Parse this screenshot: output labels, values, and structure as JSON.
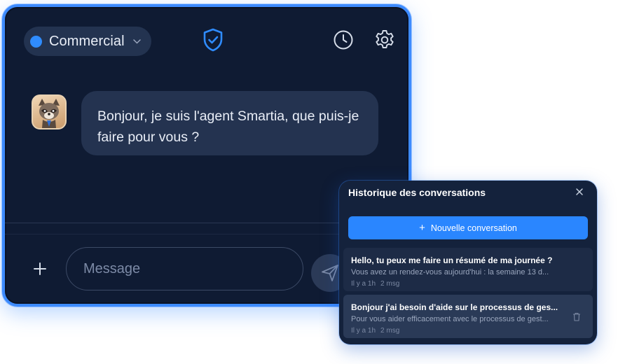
{
  "chat": {
    "agent": {
      "name": "Commercial",
      "dot_color": "#2f8cff"
    },
    "message": "Bonjour, je suis l'agent Smartia, que puis-je faire pour vous ?",
    "input_placeholder": "Message"
  },
  "history": {
    "title": "Historique des conversations",
    "new_label": "Nouvelle conversation",
    "items": [
      {
        "title": "Hello, tu peux me faire un résumé de ma journée ?",
        "preview": "Vous avez un rendez-vous aujourd'hui : la semaine 13 d...",
        "time": "Il y a 1h",
        "count": "2 msg"
      },
      {
        "title": "Bonjour j'ai besoin d'aide sur le processus de ges...",
        "preview": "Pour vous aider efficacement avec le processus de gest...",
        "time": "Il y a 1h",
        "count": "2 msg"
      }
    ]
  },
  "colors": {
    "accent": "#2a86ff",
    "background": "#0f1b33",
    "bubble": "#243350"
  }
}
